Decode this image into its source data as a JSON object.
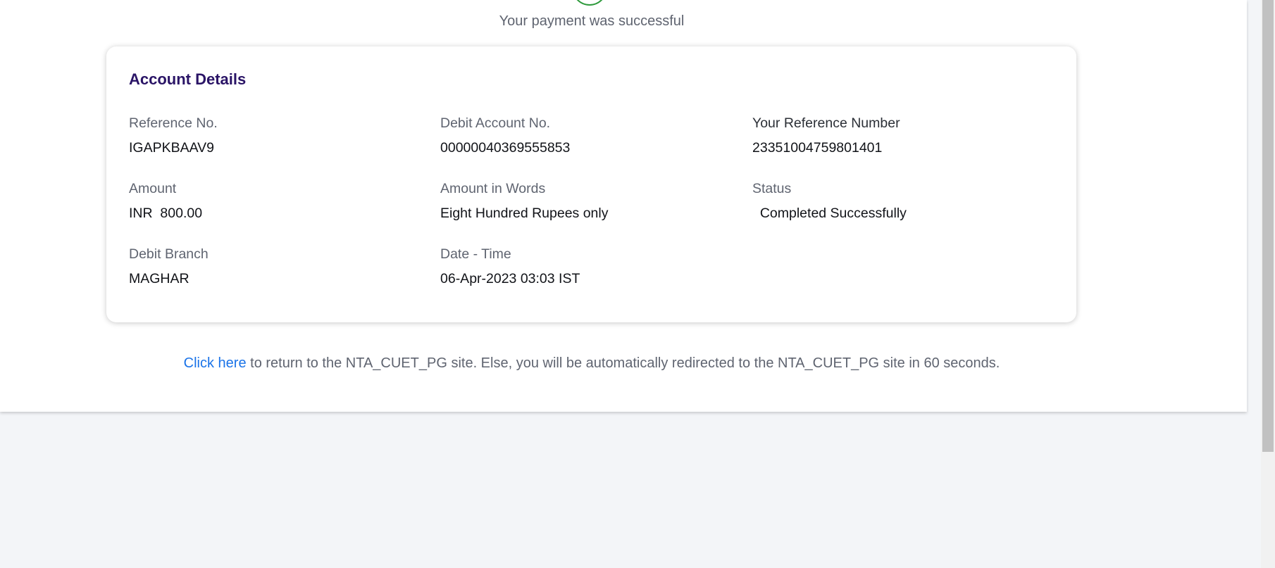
{
  "status_message": "Your payment was successful",
  "card": {
    "title": "Account Details",
    "fields": [
      {
        "label": "Reference No.",
        "value": "IGAPKBAAV9"
      },
      {
        "label": "Debit Account No.",
        "value": "00000040369555853"
      },
      {
        "label": "Your Reference Number",
        "value": "23351004759801401"
      },
      {
        "label": "Amount",
        "value": "INR  800.00"
      },
      {
        "label": "Amount in Words",
        "value": "Eight Hundred Rupees only"
      },
      {
        "label": "Status",
        "value": "  Completed Successfully"
      },
      {
        "label": "Debit Branch",
        "value": "MAGHAR"
      },
      {
        "label": "Date - Time",
        "value": "06-Apr-2023 03:03 IST"
      }
    ]
  },
  "redirect": {
    "link_text": "Click here",
    "message": " to return to the NTA_CUET_PG site. Else, you will be automatically redirected to the NTA_CUET_PG site in 60 seconds."
  },
  "colors": {
    "title": "#2a1466",
    "link": "#1a73e8",
    "success": "#2e9a3c"
  }
}
